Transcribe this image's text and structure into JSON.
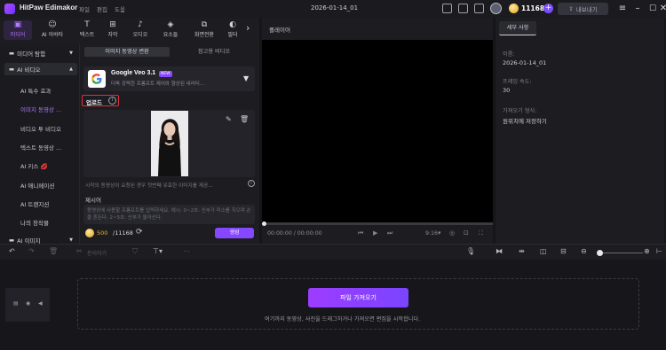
{
  "app": {
    "name": "HitPaw Edimakor",
    "menu": [
      "파일",
      "편집",
      "도움"
    ],
    "project_title": "2026-01-14_01",
    "credits": "11168",
    "export_label": "내보내기"
  },
  "media_tabs": [
    {
      "label": "미디어",
      "icon": "media-icon"
    },
    {
      "label": "AI 아바타",
      "icon": "avatar-icon"
    },
    {
      "label": "텍스트",
      "icon": "text-icon"
    },
    {
      "label": "자막",
      "icon": "subtitle-icon"
    },
    {
      "label": "오디오",
      "icon": "audio-icon"
    },
    {
      "label": "요소들",
      "icon": "elements-icon"
    },
    {
      "label": "화면전환",
      "icon": "transition-icon"
    },
    {
      "label": "필터",
      "icon": "filter-icon"
    }
  ],
  "categories": {
    "media_library": "미디어 탐험",
    "ai_video": "AI 비디오",
    "sub_items": [
      "AI 특수 효과",
      "이미지 동영상 ...",
      "비디오 투 비디오",
      "텍스트 동영상 ...",
      "AI 키스 💋",
      "AI 애니메이션",
      "AI 트랜지션",
      "나의 창작물"
    ],
    "ai_image": "AI 이미지"
  },
  "generator": {
    "segments": [
      "이미지 동영상 변환",
      "참고용 비디오"
    ],
    "model_name": "Google Veo 3.1",
    "model_badge": "NEW",
    "model_desc": "더욱 강력한 프롬프트 제어와 향상된 내러티...",
    "upload_label": "업로드",
    "image_hint": "시작의 동영상이 요청된 경우 첫번째 유효한 이미지를 제공...",
    "prompt_label": "제시어",
    "prompt_placeholder": "동영상에 사용할 프롬프트를 입력하세요. 예시: 0~2초: 신부가 미소를 지으며 손을 흔든다. 2~5초: 신부가 돌아선다.",
    "credits_used": "500",
    "credits_total": "/11168",
    "generate_label": "생성"
  },
  "player": {
    "title": "플레이어",
    "time": "00:00:00 / 00:00:00",
    "speed": "9:16"
  },
  "properties": {
    "tab": "세부 사항",
    "fields": [
      {
        "label": "이름:",
        "value": "2026-01-14_01"
      },
      {
        "label": "프레임 속도:",
        "value": "30"
      },
      {
        "label": "가져오기 형식:",
        "value": "원위치에 저장하기"
      }
    ]
  },
  "timeline": {
    "split_label": "분리하기",
    "import_label": "파일 가져오기",
    "drop_hint": "여기까지 동영상, 사진을 드래그하거나 가져오면 편집을 시작합니다."
  },
  "colors": {
    "accent": "#8648ff",
    "upload_highlight": "#e0313a"
  }
}
